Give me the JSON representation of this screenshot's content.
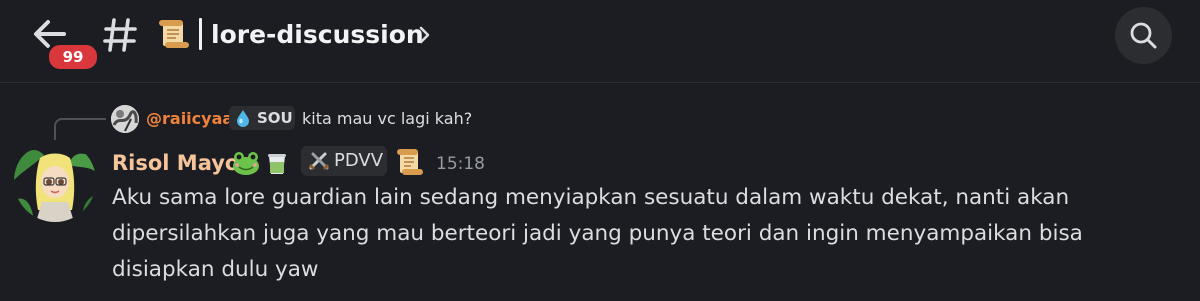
{
  "header": {
    "back_label": "Back",
    "unread_count": "99",
    "channel_emoji": "scroll-icon",
    "channel_name": "lore-discussion",
    "chevron": "chevron-right-icon",
    "search": "search-icon"
  },
  "reply": {
    "author": "@raiicyaa",
    "tag_icon": "water-drop-icon",
    "tag_label": "SOU",
    "text": "kita mau vc lagi kah?"
  },
  "message": {
    "author": "Risol Mayo",
    "author_emojis": [
      "frog-face-icon",
      "tea-cup-icon"
    ],
    "role_icon": "crossed-swords-icon",
    "role_label": "PDVV",
    "role_emoji": "scroll-icon",
    "timestamp": "15:18",
    "body": "Aku sama lore guardian lain sedang menyiapkan sesuatu dalam waktu dekat, nanti akan dipersilahkan juga yang mau berteori jadi yang punya teori dan ingin menyampaikan bisa disiapkan dulu yaw"
  },
  "colors": {
    "background": "#1c1d22",
    "badge": "#da373c",
    "reply_author": "#f0823c",
    "author": "#f5c49a",
    "timestamp": "#949ba4",
    "text": "#dbdee1"
  }
}
